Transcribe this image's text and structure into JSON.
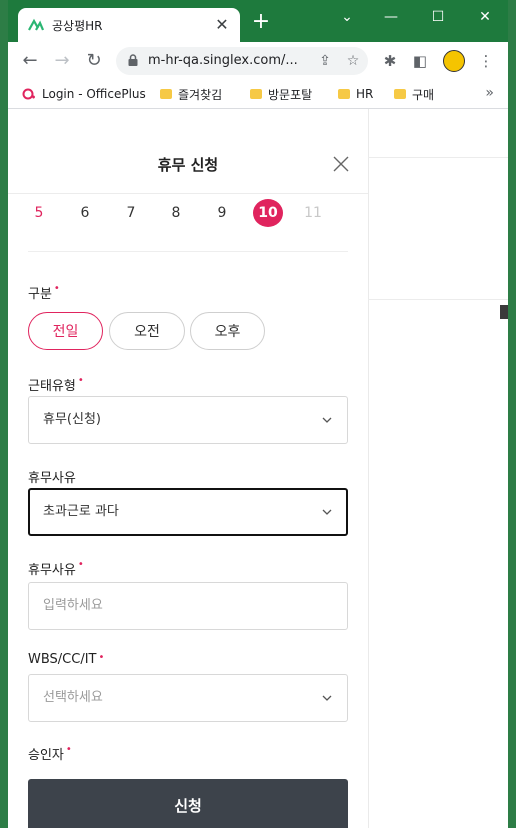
{
  "browser": {
    "tab_title": "공상평HR",
    "tab_close": "✕",
    "new_tab": "+",
    "url": "m-hr-qa.singlex.com/...",
    "window_controls": {
      "minimize": "⌄",
      "restore": "—",
      "maximize": "☐",
      "close": "✕"
    },
    "bookmarks": [
      {
        "label": "Login - OfficePlus",
        "icon": "officeplus-icon"
      },
      {
        "label": "즐겨찾김",
        "icon": "folder-icon"
      },
      {
        "label": "방문포탈",
        "icon": "folder-icon"
      },
      {
        "label": "HR",
        "icon": "folder-icon"
      },
      {
        "label": "구매",
        "icon": "folder-icon"
      }
    ],
    "bookmarks_more": "»"
  },
  "sheet": {
    "title": "휴무 신청",
    "days": [
      "5",
      "6",
      "7",
      "8",
      "9",
      "10",
      "11"
    ],
    "selected_day": "10",
    "section_type": {
      "label": "구분",
      "options": [
        "전일",
        "오전",
        "오후"
      ],
      "selected": "전일"
    },
    "attendance_type": {
      "label": "근태유형",
      "value": "휴무(신청)"
    },
    "reason_select": {
      "label": "휴무사유",
      "value": "초과근로 과다"
    },
    "reason_input": {
      "label": "휴무사유",
      "placeholder": "입력하세요"
    },
    "wbs": {
      "label": "WBS/CC/IT",
      "placeholder": "선택하세요"
    },
    "approver": {
      "label": "승인자"
    },
    "submit_label": "신청",
    "required_mark": "•"
  },
  "colors": {
    "accent": "#e0245e",
    "button": "#3d434b",
    "titlebar": "#1e7a3d"
  }
}
